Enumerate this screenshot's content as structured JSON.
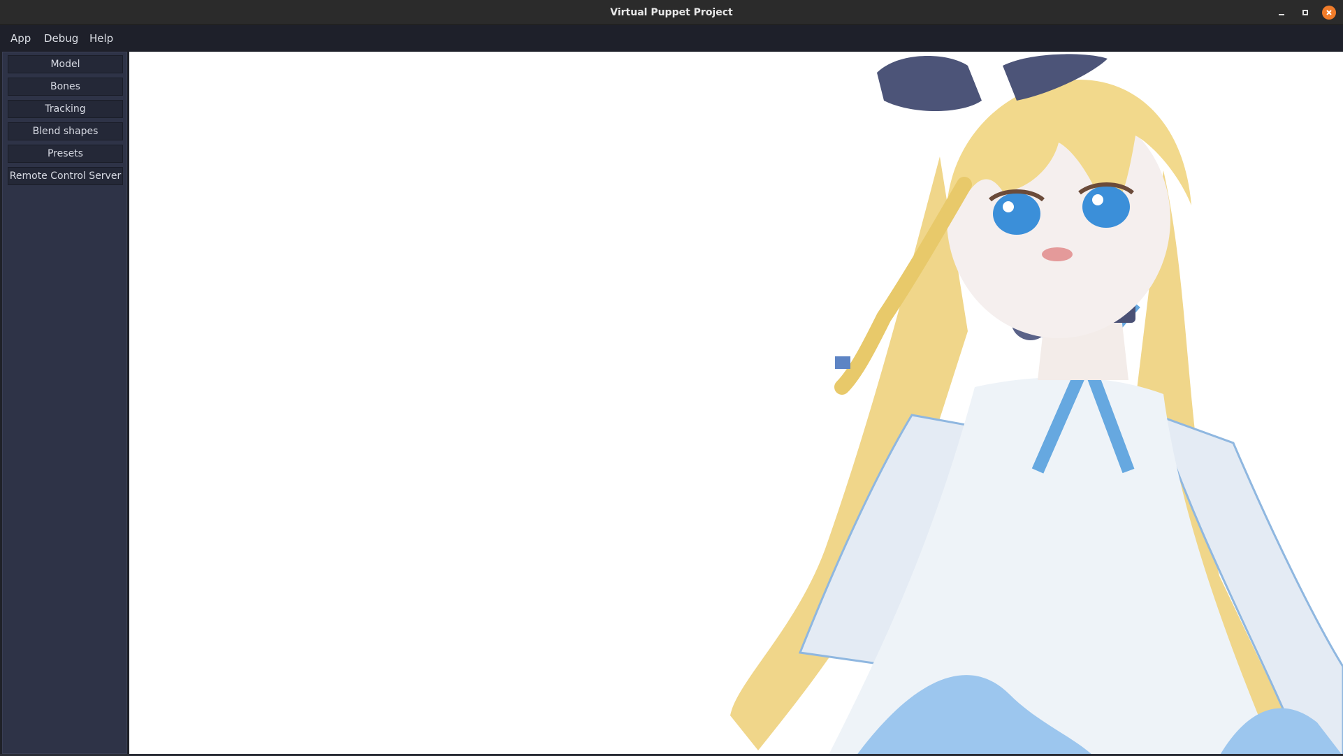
{
  "window": {
    "title": "Virtual Puppet Project",
    "minimize_icon": "minimize-icon",
    "maximize_icon": "maximize-icon",
    "close_icon": "close-icon"
  },
  "menubar": {
    "items": [
      {
        "label": "App"
      },
      {
        "label": "Debug"
      },
      {
        "label": "Help"
      }
    ]
  },
  "sidebar": {
    "buttons": [
      {
        "label": "Model"
      },
      {
        "label": "Bones"
      },
      {
        "label": "Tracking"
      },
      {
        "label": "Blend shapes"
      },
      {
        "label": "Presets"
      },
      {
        "label": "Remote Control Server"
      }
    ]
  },
  "viewport": {
    "content": "3d-avatar-model"
  },
  "colors": {
    "titlebar": "#2b2b2b",
    "menubar": "#1e202a",
    "sidebar": "#2e3347",
    "button": "#242837",
    "close_accent": "#f07c2a",
    "viewport_bg": "#ffffff"
  }
}
